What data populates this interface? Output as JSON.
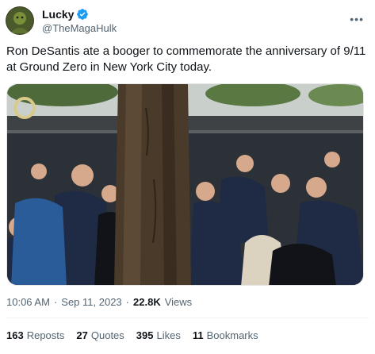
{
  "author": {
    "display_name": "Lucky",
    "handle": "@TheMagaHulk",
    "verified_color": "#1d9bf0"
  },
  "tweet": {
    "text": "Ron DeSantis ate a booger to commemorate the anniversary of 9/11 at Ground Zero in New York City today."
  },
  "meta": {
    "time": "10:06 AM",
    "separator": "·",
    "date": "Sep 11, 2023",
    "views_count": "22.8K",
    "views_label": "Views"
  },
  "stats": [
    {
      "count": "163",
      "label": "Reposts"
    },
    {
      "count": "27",
      "label": "Quotes"
    },
    {
      "count": "395",
      "label": "Likes"
    },
    {
      "count": "11",
      "label": "Bookmarks"
    }
  ],
  "icons": {
    "verified": "verified-badge-icon",
    "more": "more-options-icon"
  }
}
